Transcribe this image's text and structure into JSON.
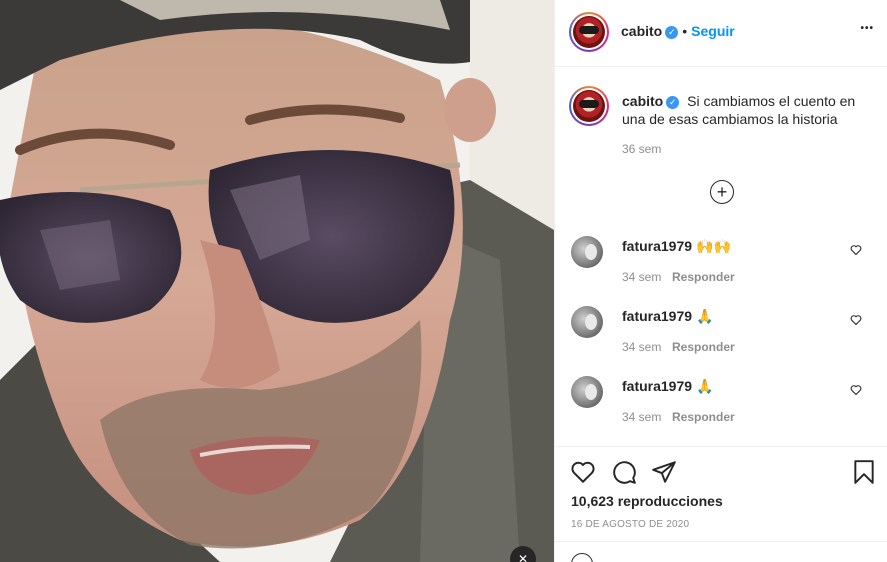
{
  "post": {
    "author": "cabito",
    "follow_label": "Seguir",
    "dot": "•",
    "more_label": "•••",
    "caption": "Si cambiamos el cuento en una de esas cambiamos la historia",
    "caption_time": "36 sem",
    "load_more_label": "+",
    "views": "10,623 reproducciones",
    "date": "16 DE AGOSTO DE 2020",
    "verified_mark": "✓"
  },
  "comments": [
    {
      "user": "fatura1979",
      "text": "🙌🙌",
      "time": "34 sem",
      "reply_label": "Responder"
    },
    {
      "user": "fatura1979",
      "text": "🙏",
      "time": "34 sem",
      "reply_label": "Responder"
    },
    {
      "user": "fatura1979",
      "text": "🙏",
      "time": "34 sem",
      "reply_label": "Responder"
    }
  ],
  "icons": {
    "like": "heart-icon",
    "comment": "comment-icon",
    "share": "paper-plane-icon",
    "save": "bookmark-icon",
    "more": "more-options-icon",
    "load_more": "plus-circle-icon",
    "verified": "verified-badge-icon"
  },
  "colors": {
    "accent": "#0095f6",
    "verified": "#3897f0",
    "muted": "#8e8e8e",
    "text": "#262626",
    "border": "#efefef"
  }
}
